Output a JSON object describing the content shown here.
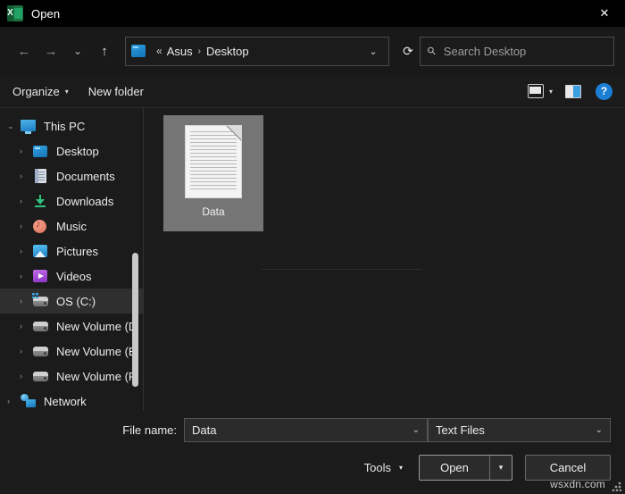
{
  "window": {
    "title": "Open",
    "app_icon": "excel-icon",
    "close_label": "✕"
  },
  "nav": {
    "back": "←",
    "forward": "→",
    "recent": "⌄",
    "up": "↑",
    "refresh": "⟳",
    "address": {
      "prefix": "«",
      "crumbs": [
        "Asus",
        "Desktop"
      ],
      "separator": "›",
      "dropdown": "⌄"
    },
    "search": {
      "placeholder": "Search Desktop",
      "icon": "search-icon"
    }
  },
  "toolbar": {
    "organize_label": "Organize",
    "organize_caret": "▾",
    "new_folder_label": "New folder",
    "view_icon": "view-options-icon",
    "view_caret": "▾",
    "preview_pane_icon": "preview-pane-icon",
    "help_label": "?"
  },
  "sidebar": {
    "items": [
      {
        "label": "This PC",
        "icon": "ic-pc",
        "level": 0,
        "twisty": "⌄",
        "selected": false
      },
      {
        "label": "Desktop",
        "icon": "ic-desktop",
        "level": 1,
        "twisty": "›",
        "selected": false
      },
      {
        "label": "Documents",
        "icon": "ic-doc",
        "level": 1,
        "twisty": "›",
        "selected": false
      },
      {
        "label": "Downloads",
        "icon": "ic-down",
        "level": 1,
        "twisty": "›",
        "selected": false
      },
      {
        "label": "Music",
        "icon": "ic-music",
        "level": 1,
        "twisty": "›",
        "selected": false
      },
      {
        "label": "Pictures",
        "icon": "ic-pic",
        "level": 1,
        "twisty": "›",
        "selected": false
      },
      {
        "label": "Videos",
        "icon": "ic-vid",
        "level": 1,
        "twisty": "›",
        "selected": false
      },
      {
        "label": "OS (C:)",
        "icon": "ic-drive os",
        "level": 1,
        "twisty": "›",
        "selected": true
      },
      {
        "label": "New Volume (D",
        "icon": "ic-drive",
        "level": 1,
        "twisty": "›",
        "selected": false
      },
      {
        "label": "New Volume (E",
        "icon": "ic-drive",
        "level": 1,
        "twisty": "›",
        "selected": false
      },
      {
        "label": "New Volume (F",
        "icon": "ic-drive",
        "level": 1,
        "twisty": "›",
        "selected": false
      },
      {
        "label": "Network",
        "icon": "ic-net",
        "level": 0,
        "twisty": "›",
        "selected": false
      }
    ]
  },
  "filelist": {
    "files": [
      {
        "name": "Data",
        "icon": "text-document-icon",
        "selected": true
      }
    ]
  },
  "footer": {
    "filename_label": "File name:",
    "filename_value": "Data",
    "filetype_value": "Text Files",
    "combo_caret": "⌄",
    "tools_label": "Tools",
    "tools_caret": "▾",
    "open_label": "Open",
    "open_caret": "▾",
    "cancel_label": "Cancel"
  },
  "watermark": {
    "text": "wsxdn.com"
  },
  "colors": {
    "window_bg": "#1b1b1b",
    "titlebar_bg": "#000000",
    "selection_bg": "#757575",
    "tree_selected_bg": "#2f2f2f",
    "accent_help": "#1a7fd4",
    "excel_green": "#1d6f42"
  }
}
